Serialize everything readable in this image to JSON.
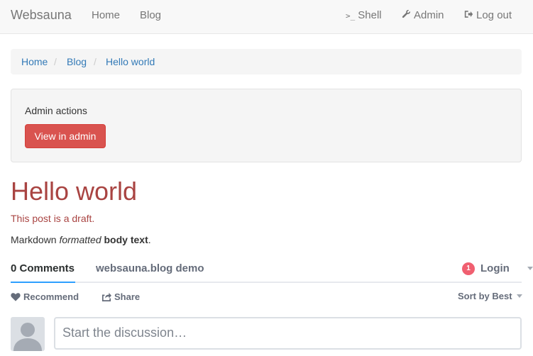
{
  "navbar": {
    "brand": "Websauna",
    "home": "Home",
    "blog": "Blog",
    "shell": "Shell",
    "shell_icon": ">_",
    "admin": "Admin",
    "logout": "Log out"
  },
  "breadcrumb": {
    "items": [
      "Home",
      "Blog",
      "Hello world"
    ],
    "separator": "/"
  },
  "admin_panel": {
    "label": "Admin actions",
    "button": "View in admin"
  },
  "post": {
    "title": "Hello world",
    "draft_note": "This post is a draft.",
    "body_prefix": "Markdown ",
    "body_em": "formatted",
    "body_space": " ",
    "body_strong": "body text",
    "body_suffix": "."
  },
  "comments": {
    "count_tab": "0 Comments",
    "site_tab": "websauna.blog demo",
    "login_badge": "1",
    "login": "Login",
    "recommend": "Recommend",
    "share": "Share",
    "sort": "Sort by Best",
    "placeholder": "Start the discussion…"
  },
  "colors": {
    "draft_red": "#a94442",
    "danger_button": "#d9534f",
    "link_blue": "#337ab7",
    "tab_accent": "#2e9fff",
    "badge": "#f05f70"
  }
}
